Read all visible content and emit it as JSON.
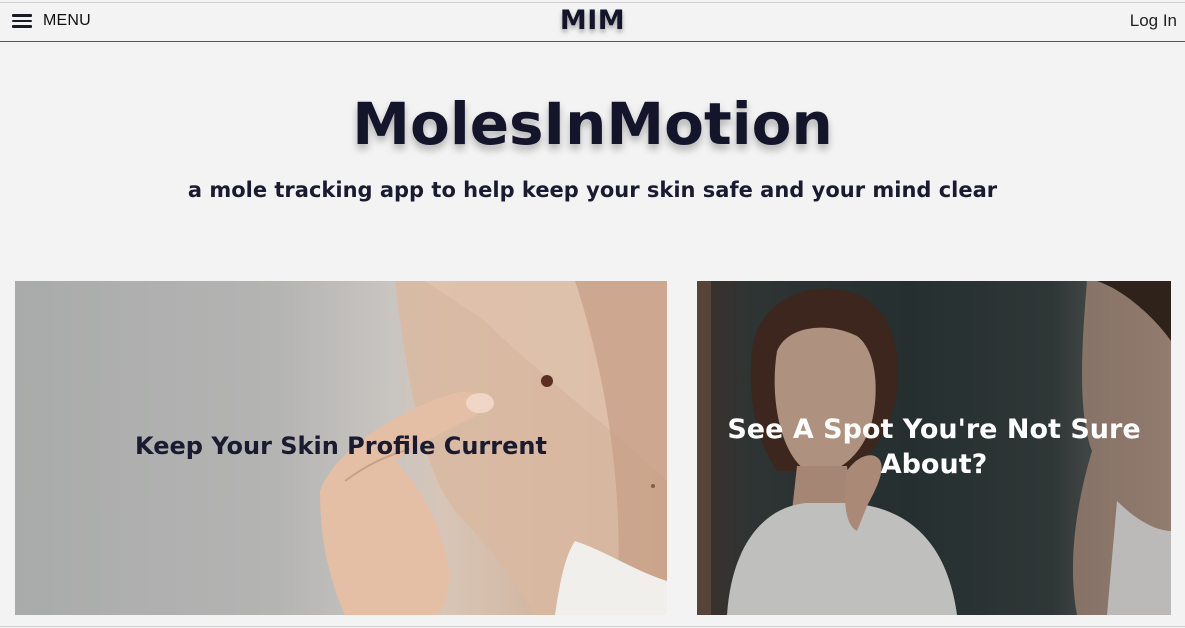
{
  "header": {
    "menu_label": "MENU",
    "logo_text": "MIM",
    "login_label": "Log In"
  },
  "hero": {
    "title": "MolesInMotion",
    "subtitle": "a mole tracking app to help keep your skin safe and your mind clear"
  },
  "cards": [
    {
      "caption": "Keep Your Skin Profile Current"
    },
    {
      "caption": "See A Spot You're Not Sure About?"
    }
  ],
  "colors": {
    "navy_text": "#14142a",
    "page_background": "#f3f3f3",
    "white_text": "#ffffff"
  }
}
